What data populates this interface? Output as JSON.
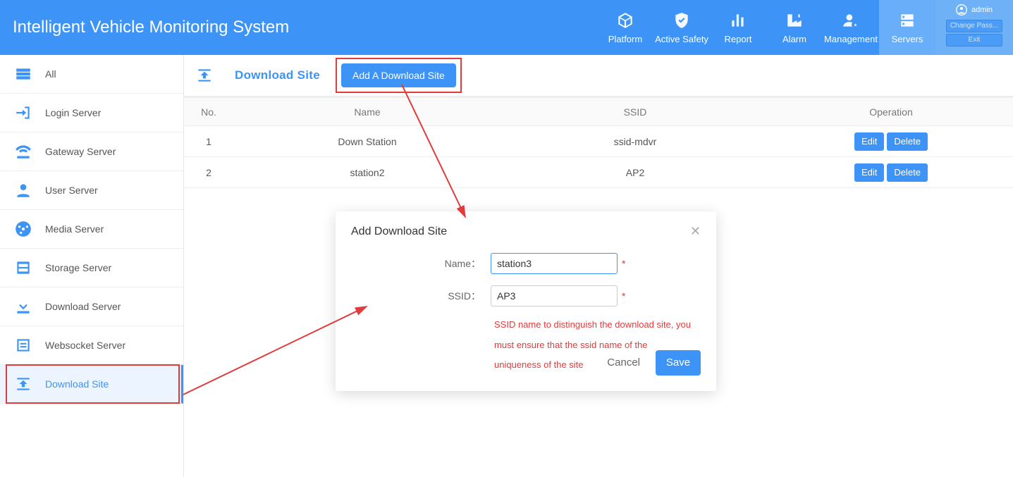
{
  "app_title": "Intelligent Vehicle Monitoring System",
  "user": {
    "name": "admin",
    "change_pw": "Change Pass...",
    "exit": "Exit"
  },
  "nav": [
    {
      "id": "platform",
      "label": "Platform"
    },
    {
      "id": "active-safety",
      "label": "Active Safety"
    },
    {
      "id": "report",
      "label": "Report"
    },
    {
      "id": "alarm",
      "label": "Alarm"
    },
    {
      "id": "management",
      "label": "Management"
    },
    {
      "id": "servers",
      "label": "Servers",
      "active": true
    }
  ],
  "sidebar": {
    "items": [
      {
        "id": "all",
        "label": "All"
      },
      {
        "id": "login",
        "label": "Login Server"
      },
      {
        "id": "gateway",
        "label": "Gateway Server"
      },
      {
        "id": "user",
        "label": "User Server"
      },
      {
        "id": "media",
        "label": "Media Server"
      },
      {
        "id": "storage",
        "label": "Storage Server"
      },
      {
        "id": "download",
        "label": "Download Server"
      },
      {
        "id": "websocket",
        "label": "Websocket Server"
      },
      {
        "id": "dl-site",
        "label": "Download Site",
        "active": true,
        "highlighted": true
      }
    ]
  },
  "page": {
    "title": "Download Site",
    "add_button": "Add A Download Site"
  },
  "table": {
    "headers": {
      "no": "No.",
      "name": "Name",
      "ssid": "SSID",
      "op": "Operation"
    },
    "op_edit": "Edit",
    "op_delete": "Delete",
    "rows": [
      {
        "no": "1",
        "name": "Down Station",
        "ssid": "ssid-mdvr"
      },
      {
        "no": "2",
        "name": "station2",
        "ssid": "AP2"
      }
    ]
  },
  "modal": {
    "title": "Add Download Site",
    "name_label": "Name：",
    "ssid_label": "SSID：",
    "name_value": "station3",
    "ssid_value": "AP3",
    "hint": "SSID name to distinguish the download site, you must ensure that the ssid name of the uniqueness of the site",
    "cancel": "Cancel",
    "save": "Save"
  }
}
